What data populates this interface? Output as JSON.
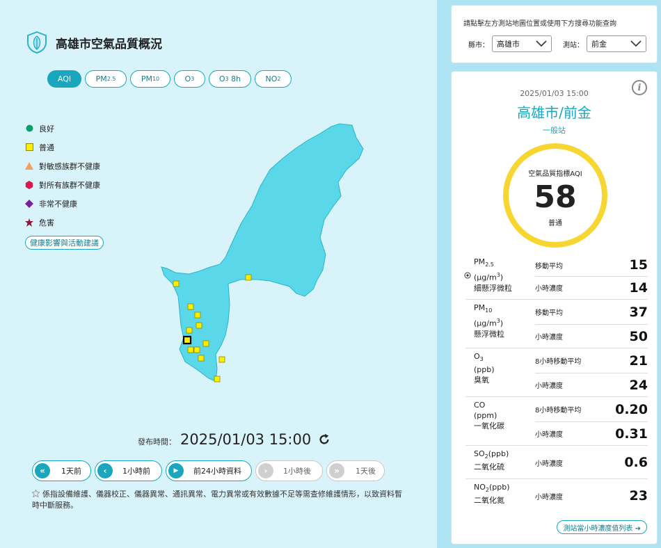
{
  "header": {
    "title": "高雄市空氣品質概況"
  },
  "tabs": [
    {
      "main": "AQI",
      "sub": ""
    },
    {
      "main": "PM",
      "sub": "2.5"
    },
    {
      "main": "PM",
      "sub": "10"
    },
    {
      "main": "O",
      "sub": "3"
    },
    {
      "main": "O",
      "sub": "3",
      "suffix": " 8h"
    },
    {
      "main": "NO",
      "sub": "2"
    }
  ],
  "legend": {
    "items": [
      "良好",
      "普通",
      "對敏感族群不健康",
      "對所有族群不健康",
      "非常不健康",
      "危害"
    ],
    "colors": [
      "#0e9a6b",
      "#ffee00",
      "#f5a05a",
      "#d61a4b",
      "#7a1fa0",
      "#8b1a3a"
    ],
    "health_button": "健康影響與活動建議"
  },
  "map": {
    "fill": "#5ad7e9",
    "stroke": "#2ab4c9",
    "marker_color": "#ffee00"
  },
  "publish": {
    "label": "發布時間：",
    "value": "2025/01/03 15:00"
  },
  "nav": [
    {
      "label": "1天前",
      "icon": "«",
      "disabled": false
    },
    {
      "label": "1小時前",
      "icon": "‹",
      "disabled": false
    },
    {
      "label": "前24小時資料",
      "icon": "▶",
      "disabled": false
    },
    {
      "label": "1小時後",
      "icon": "›",
      "disabled": true
    },
    {
      "label": "1天後",
      "icon": "»",
      "disabled": true
    }
  ],
  "note": "係指設備維護、儀器校正、儀器異常、通訊異常、電力異常或有效數據不足等需查修維護情形，以致資料暫時中斷服務。",
  "search": {
    "hint": "請點擊左方測站地圖位置或使用下方搜尋功能查詢",
    "county_label": "縣市：",
    "county_value": "高雄市",
    "station_label": "測站：",
    "station_value": "前金"
  },
  "station": {
    "time": "2025/01/03 15:00",
    "name": "高雄市/前金",
    "type": "一般站",
    "aqi_label": "空氣品質指標AQI",
    "aqi_value": "58",
    "aqi_status": "普通"
  },
  "pollutants": {
    "pm25": {
      "name": "PM",
      "sub": "2.5",
      "unit": "(μg/m",
      "unit_sup": "3",
      "unit_end": ")",
      "cn": "細懸浮微粒",
      "m1": "移動平均",
      "v1": "15",
      "m2": "小時濃度",
      "v2": "14"
    },
    "pm10": {
      "name": "PM",
      "sub": "10",
      "unit": "(μg/m",
      "unit_sup": "3",
      "unit_end": ")",
      "cn": "懸浮微粒",
      "m1": "移動平均",
      "v1": "37",
      "m2": "小時濃度",
      "v2": "50"
    },
    "o3": {
      "name": "O",
      "sub": "3",
      "unit": "(ppb)",
      "cn": "臭氧",
      "m1": "8小時移動平均",
      "v1": "21",
      "m2": "小時濃度",
      "v2": "24"
    },
    "co": {
      "name": "CO",
      "unit": "(ppm)",
      "cn": "一氧化碳",
      "m1": "8小時移動平均",
      "v1": "0.20",
      "m2": "小時濃度",
      "v2": "0.31"
    },
    "so2": {
      "name": "SO",
      "sub": "2",
      "unit": "(ppb)",
      "cn": "二氧化硫",
      "m2": "小時濃度",
      "v2": "0.6"
    },
    "no2": {
      "name": "NO",
      "sub": "2",
      "unit": "(ppb)",
      "cn": "二氧化氮",
      "m2": "小時濃度",
      "v2": "23"
    }
  },
  "list_button": "測站當小時濃度值列表 ➔"
}
